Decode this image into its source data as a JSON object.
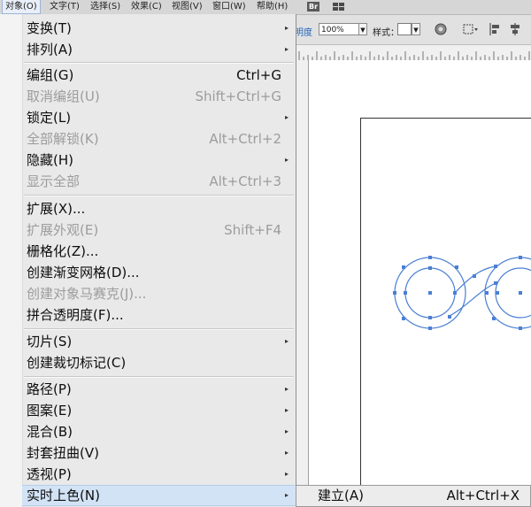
{
  "menubar": {
    "items": [
      "对象(O)",
      "文字(T)",
      "选择(S)",
      "效果(C)",
      "视图(V)",
      "窗口(W)",
      "帮助(H)"
    ],
    "bridge_label": "Br"
  },
  "controlbar": {
    "opacity_label": "明度",
    "opacity_value": "100%",
    "style_label": "样式："
  },
  "object_menu": {
    "items": [
      {
        "label": "变换(T)",
        "shortcut": "",
        "submenu": true,
        "enabled": true
      },
      {
        "label": "排列(A)",
        "shortcut": "",
        "submenu": true,
        "enabled": true
      },
      {
        "label": "编组(G)",
        "shortcut": "Ctrl+G",
        "submenu": false,
        "enabled": true
      },
      {
        "label": "取消编组(U)",
        "shortcut": "Shift+Ctrl+G",
        "submenu": false,
        "enabled": false
      },
      {
        "label": "锁定(L)",
        "shortcut": "",
        "submenu": true,
        "enabled": true
      },
      {
        "label": "全部解锁(K)",
        "shortcut": "Alt+Ctrl+2",
        "submenu": false,
        "enabled": false
      },
      {
        "label": "隐藏(H)",
        "shortcut": "",
        "submenu": true,
        "enabled": true
      },
      {
        "label": "显示全部",
        "shortcut": "Alt+Ctrl+3",
        "submenu": false,
        "enabled": false
      },
      {
        "label": "扩展(X)...",
        "shortcut": "",
        "submenu": false,
        "enabled": true
      },
      {
        "label": "扩展外观(E)",
        "shortcut": "Shift+F4",
        "submenu": false,
        "enabled": false
      },
      {
        "label": "栅格化(Z)...",
        "shortcut": "",
        "submenu": false,
        "enabled": true
      },
      {
        "label": "创建渐变网格(D)...",
        "shortcut": "",
        "submenu": false,
        "enabled": true
      },
      {
        "label": "创建对象马赛克(J)...",
        "shortcut": "",
        "submenu": false,
        "enabled": false
      },
      {
        "label": "拼合透明度(F)...",
        "shortcut": "",
        "submenu": false,
        "enabled": true
      },
      {
        "label": "切片(S)",
        "shortcut": "",
        "submenu": true,
        "enabled": true
      },
      {
        "label": "创建裁切标记(C)",
        "shortcut": "",
        "submenu": false,
        "enabled": true
      },
      {
        "label": "路径(P)",
        "shortcut": "",
        "submenu": true,
        "enabled": true
      },
      {
        "label": "图案(E)",
        "shortcut": "",
        "submenu": true,
        "enabled": true
      },
      {
        "label": "混合(B)",
        "shortcut": "",
        "submenu": true,
        "enabled": true
      },
      {
        "label": "封套扭曲(V)",
        "shortcut": "",
        "submenu": true,
        "enabled": true
      },
      {
        "label": "透视(P)",
        "shortcut": "",
        "submenu": true,
        "enabled": true
      },
      {
        "label": "实时上色(N)",
        "shortcut": "",
        "submenu": true,
        "enabled": true
      }
    ]
  },
  "live_paint_submenu": {
    "items": [
      {
        "label": "建立(A)",
        "shortcut": "Alt+Ctrl+X"
      }
    ]
  },
  "icons": {
    "submenu_arrow": "▸",
    "dropdown_arrow": "▼"
  },
  "colors": {
    "selection_blue": "#4a7fd4",
    "highlight": "#d3e3f6",
    "disabled_text": "#9c9c9c"
  }
}
